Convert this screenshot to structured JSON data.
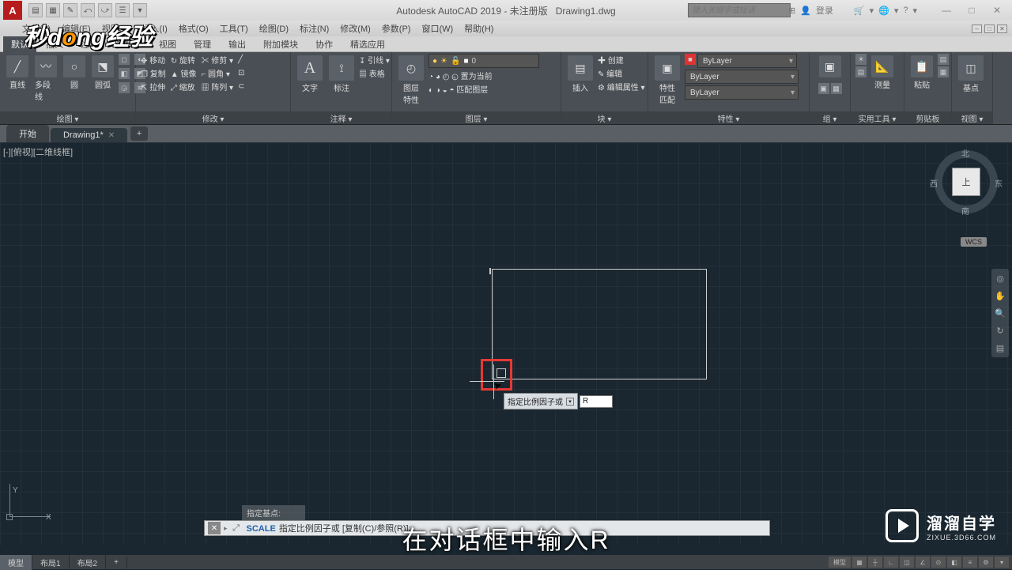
{
  "title": {
    "app": "Autodesk AutoCAD 2019 - 未注册版",
    "doc": "Drawing1.dwg",
    "logo": "A"
  },
  "qat": [
    "▤",
    "▦",
    "✎",
    "⤺",
    "⤻",
    "☰",
    "▾"
  ],
  "search": {
    "placeholder": "键入关键字或短语"
  },
  "login": {
    "icon": "👤",
    "text": "登录"
  },
  "help_icons": [
    "🛒",
    "▾",
    "🌐",
    "▾",
    "?",
    "▾"
  ],
  "win": {
    "min": "—",
    "max": "□",
    "close": "✕"
  },
  "menus": [
    "文件(F)",
    "编辑(E)",
    "视图(V)",
    "插入(I)",
    "格式(O)",
    "工具(T)",
    "绘图(D)",
    "标注(N)",
    "修改(M)",
    "参数(P)",
    "窗口(W)",
    "帮助(H)"
  ],
  "ribbon_tabs": [
    "默认",
    "插入",
    "注释",
    "参数化",
    "视图",
    "管理",
    "输出",
    "附加模块",
    "协作",
    "精选应用"
  ],
  "panels": {
    "draw": {
      "title": "绘图 ▾",
      "big": [
        {
          "icon": "╱",
          "label": "直线"
        },
        {
          "icon": "〰",
          "label": "多段线"
        },
        {
          "icon": "○",
          "label": "圆"
        },
        {
          "icon": "⬔",
          "label": "圆弧"
        }
      ],
      "small": [
        "◻",
        "◐",
        "◧",
        "◩",
        "◶",
        "≋"
      ]
    },
    "modify": {
      "title": "修改 ▾",
      "rows": [
        [
          "✥ 移动",
          "↻ 旋转",
          "✂ 修剪 ▾",
          "╱"
        ],
        [
          "❐ 复制",
          "▲ 镜像",
          "⌐ 圆角 ▾",
          "⊡"
        ],
        [
          "⇱ 拉伸",
          "⤢ 缩放",
          "▦ 阵列 ▾",
          "⊂"
        ]
      ]
    },
    "annot": {
      "title": "注释 ▾",
      "big": [
        {
          "icon": "A",
          "label": "文字"
        },
        {
          "icon": "⟟",
          "label": "标注"
        }
      ],
      "small": [
        "↧ 引线 ▾",
        "▦ 表格"
      ]
    },
    "layer": {
      "title": "图层 ▾",
      "big": {
        "icon": "◴",
        "label": "图层\n特性"
      },
      "combo": {
        "bulb": "●",
        "sun": "☀",
        "lock": "🔓",
        "color": "■",
        "name": "0"
      },
      "rows": [
        "◔ ◕ ◴ ◵ 置为当前",
        "◐ ◑ ◒ ◓ 匹配图层"
      ]
    },
    "block": {
      "title": "块 ▾",
      "big": {
        "icon": "▤",
        "label": "插入"
      },
      "rows": [
        "✚ 创建",
        "✎ 编辑",
        "⚙ 编辑属性 ▾"
      ]
    },
    "prop": {
      "title": "特性 ▾",
      "big": {
        "icon": "▣",
        "label": "特性\n匹配"
      },
      "sels": [
        "ByLayer",
        "ByLayer",
        "ByLayer"
      ]
    },
    "group": {
      "title": "组 ▾",
      "icons": [
        "▣",
        "▦"
      ]
    },
    "util": {
      "title": "实用工具 ▾",
      "big": {
        "icon": "📐",
        "label": "测量"
      },
      "icons": [
        "☀",
        "▤"
      ]
    },
    "clip": {
      "title": "剪贴板",
      "big": {
        "icon": "📋",
        "label": "粘贴"
      },
      "icons": [
        "▤",
        "▦"
      ]
    },
    "view": {
      "title": "视图 ▾",
      "big": {
        "icon": "◫",
        "label": "基点"
      }
    }
  },
  "doc_tabs": {
    "start": "开始",
    "active": "Drawing1*",
    "plus": "+"
  },
  "viewport_label": "[-][俯视][二维线框]",
  "viewcube": {
    "top": "上",
    "n": "北",
    "s": "南",
    "e": "东",
    "w": "西",
    "wcs": "WCS"
  },
  "dynamic": {
    "prompt": "指定比例因子或",
    "value": "R"
  },
  "cmd": {
    "history": "指定基点:",
    "name": "SCALE",
    "prompt": "指定比例因子或  [复制(C)/参照(R)]:"
  },
  "ucs": {
    "x": "X",
    "y": "Y"
  },
  "bottom_tabs": [
    "模型",
    "布局1",
    "布局2",
    "+"
  ],
  "status_text": "模型",
  "subtitle": "在对话框中输入R",
  "watermark_tl": {
    "a": "秒d",
    "b": "o",
    "c": "ng经验"
  },
  "watermark_br": {
    "t1": "溜溜自学",
    "t2": "ZIXUE.3D66.COM"
  }
}
